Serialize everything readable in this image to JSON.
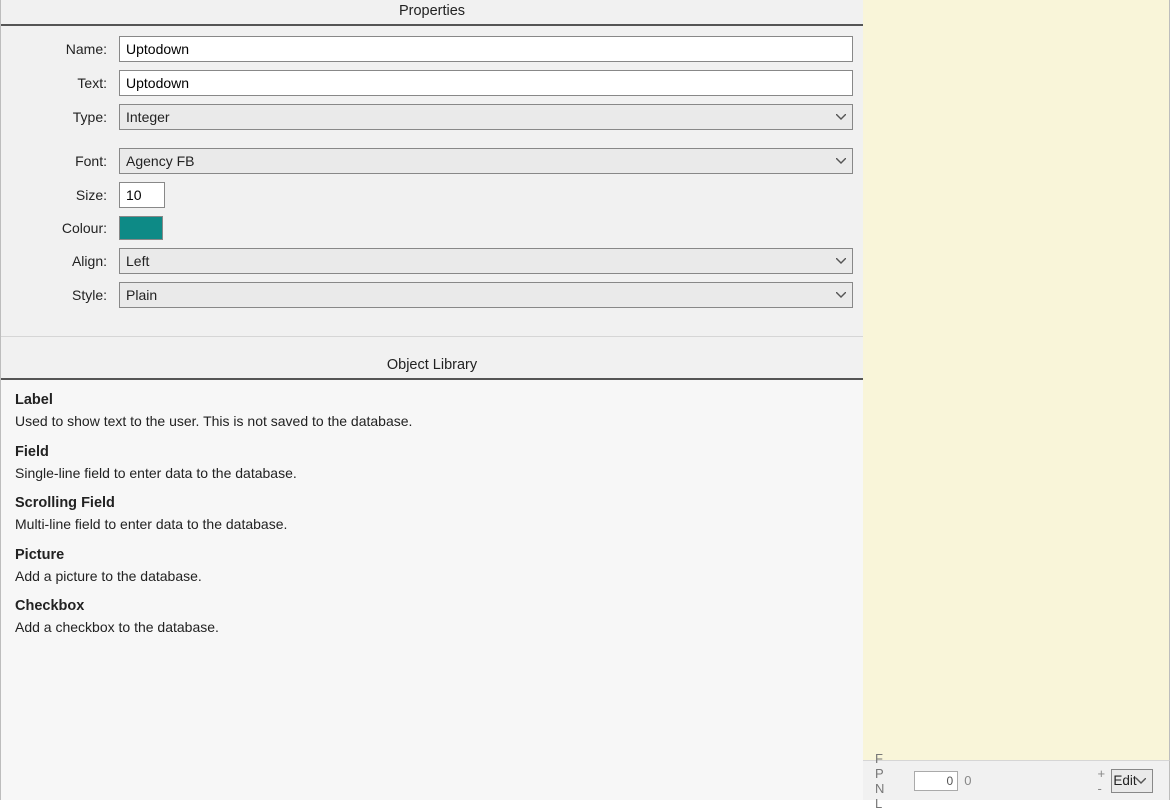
{
  "properties": {
    "title": "Properties",
    "rows": {
      "name": {
        "label": "Name:",
        "value": "Uptodown"
      },
      "text": {
        "label": "Text:",
        "value": "Uptodown"
      },
      "type": {
        "label": "Type:",
        "value": "Integer"
      },
      "font": {
        "label": "Font:",
        "value": "Agency FB"
      },
      "size": {
        "label": "Size:",
        "value": "10"
      },
      "colour": {
        "label": "Colour:",
        "value": "#0d8a86"
      },
      "align": {
        "label": "Align:",
        "value": "Left"
      },
      "style": {
        "label": "Style:",
        "value": "Plain"
      }
    }
  },
  "library": {
    "title": "Object Library",
    "items": [
      {
        "name": "Label",
        "desc": "Used to show text to the user. This is not saved to the database."
      },
      {
        "name": "Field",
        "desc": "Single-line field to enter data to the database."
      },
      {
        "name": "Scrolling Field",
        "desc": "Multi-line field to enter data to the database."
      },
      {
        "name": "Picture",
        "desc": "Add a picture to the database."
      },
      {
        "name": "Checkbox",
        "desc": "Add a checkbox to the database."
      }
    ]
  },
  "status": {
    "nav_letters": "F P N L",
    "record_current": "0",
    "record_total": "0",
    "zoom_in": "+",
    "zoom_out": "-",
    "mode": "Edit"
  }
}
